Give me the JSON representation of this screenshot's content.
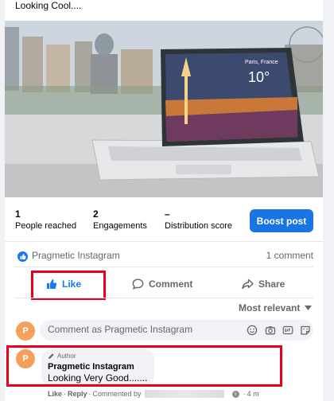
{
  "post": {
    "caption": "Looking Cool....",
    "laptop_city": "Paris, France",
    "laptop_temp": "10°"
  },
  "insights": {
    "people_reached_value": "1",
    "people_reached_label": "People reached",
    "engagements_value": "2",
    "engagements_label": "Engagements",
    "distribution_value": "–",
    "distribution_label": "Distribution score",
    "boost_label": "Boost post"
  },
  "reactions": {
    "reactor_name": "Pragmetic Instagram",
    "comment_count": "1 comment"
  },
  "actions": {
    "like_label": "Like",
    "comment_label": "Comment",
    "share_label": "Share"
  },
  "sort": {
    "label": "Most relevant"
  },
  "composer": {
    "avatar_letter": "P",
    "placeholder": "Comment as Pragmetic Instagram"
  },
  "comments": [
    {
      "avatar_letter": "P",
      "badge": "Author",
      "author": "Pragmetic Instagram",
      "text": "Looking Very Good.......",
      "like_label": "Like",
      "reply_label": "Reply",
      "commented_by_label": "Commented by",
      "time": "4 m"
    }
  ],
  "colors": {
    "accent": "#1877f2",
    "boost": "#1b74e4",
    "highlight": "#e8001c",
    "avatar": "#f5a05a"
  }
}
